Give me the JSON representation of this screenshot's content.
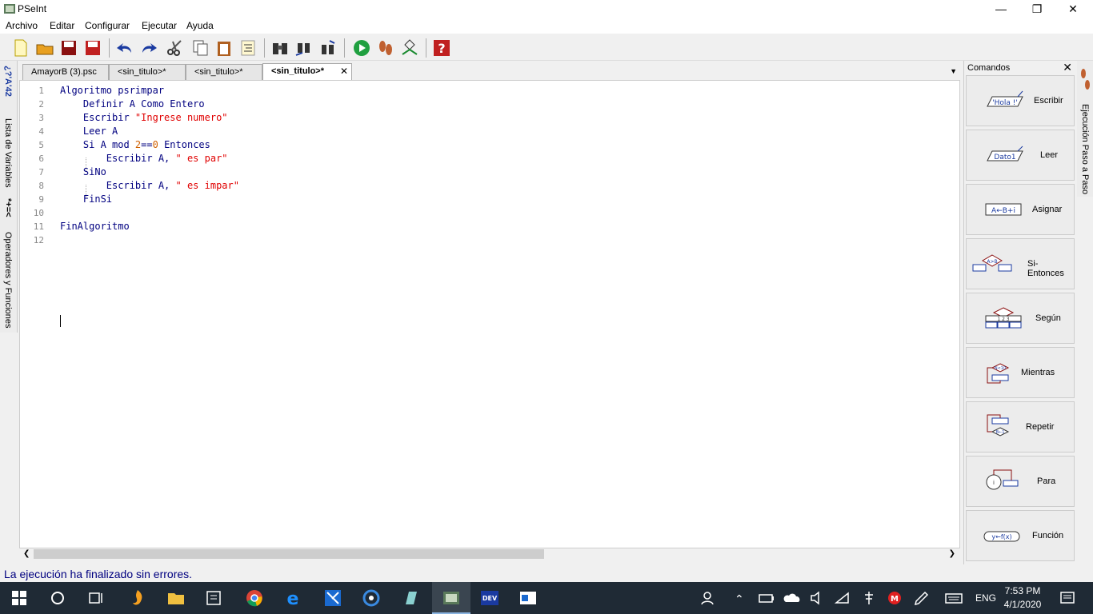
{
  "window": {
    "title": "PSeInt"
  },
  "menu": [
    "Archivo",
    "Editar",
    "Configurar",
    "Ejecutar",
    "Ayuda"
  ],
  "left_tabs": {
    "variables": "Lista de Variables",
    "operators": "Operadores y Funciones",
    "var_glyphs": "*+=<",
    "top_glyphs": "¿?'A'42"
  },
  "tabs": [
    {
      "label": "AmayorB (3).psc"
    },
    {
      "label": "<sin_titulo>*"
    },
    {
      "label": "<sin_titulo>*"
    },
    {
      "label": "<sin_titulo>*",
      "active": true
    }
  ],
  "editor": {
    "lines": [
      {
        "n": "1",
        "parts": [
          {
            "t": "Algoritmo psrimpar",
            "c": ""
          }
        ]
      },
      {
        "n": "2",
        "parts": [
          {
            "t": "    Definir A Como Entero",
            "c": ""
          }
        ]
      },
      {
        "n": "3",
        "parts": [
          {
            "t": "    Escribir ",
            "c": ""
          },
          {
            "t": "\"Ingrese numero\"",
            "c": "str"
          }
        ]
      },
      {
        "n": "4",
        "parts": [
          {
            "t": "    Leer A",
            "c": ""
          }
        ]
      },
      {
        "n": "5",
        "parts": [
          {
            "t": "    Si A mod ",
            "c": ""
          },
          {
            "t": "2",
            "c": "num"
          },
          {
            "t": "==",
            "c": ""
          },
          {
            "t": "0",
            "c": "num"
          },
          {
            "t": " Entonces",
            "c": ""
          }
        ]
      },
      {
        "n": "6",
        "parts": [
          {
            "t": "        Escribir A, ",
            "c": ""
          },
          {
            "t": "\" es par\"",
            "c": "str"
          }
        ]
      },
      {
        "n": "7",
        "parts": [
          {
            "t": "    SiNo",
            "c": ""
          }
        ]
      },
      {
        "n": "8",
        "parts": [
          {
            "t": "        Escribir A, ",
            "c": ""
          },
          {
            "t": "\" es impar\"",
            "c": "str"
          }
        ]
      },
      {
        "n": "9",
        "parts": [
          {
            "t": "    FinSi",
            "c": ""
          }
        ]
      },
      {
        "n": "10",
        "parts": [
          {
            "t": "",
            "c": ""
          }
        ]
      },
      {
        "n": "11",
        "parts": [
          {
            "t": "FinAlgoritmo",
            "c": ""
          }
        ]
      },
      {
        "n": "12",
        "parts": [
          {
            "t": "",
            "c": ""
          }
        ]
      }
    ]
  },
  "commands": {
    "title": "Comandos",
    "items": [
      {
        "label": "Escribir",
        "icon_text": "'Hola !'"
      },
      {
        "label": "Leer",
        "icon_text": "Dato1"
      },
      {
        "label": "Asignar",
        "icon_text": "A←B+i"
      },
      {
        "label": "Si-Entonces",
        "icon_text": "A>B"
      },
      {
        "label": "Según",
        "icon_text": "1 2 3"
      },
      {
        "label": "Mientras",
        "icon_text": "N<10"
      },
      {
        "label": "Repetir",
        "icon_text": "B←1"
      },
      {
        "label": "Para",
        "icon_text": "i"
      },
      {
        "label": "Función",
        "icon_text": "y←f(x)"
      }
    ]
  },
  "right_tab": {
    "label": "Ejecución Paso a Paso"
  },
  "status": {
    "text": "La ejecución ha finalizado sin errores."
  },
  "taskbar": {
    "lang": "ENG",
    "time": "7:53 PM",
    "date": "4/1/2020"
  }
}
